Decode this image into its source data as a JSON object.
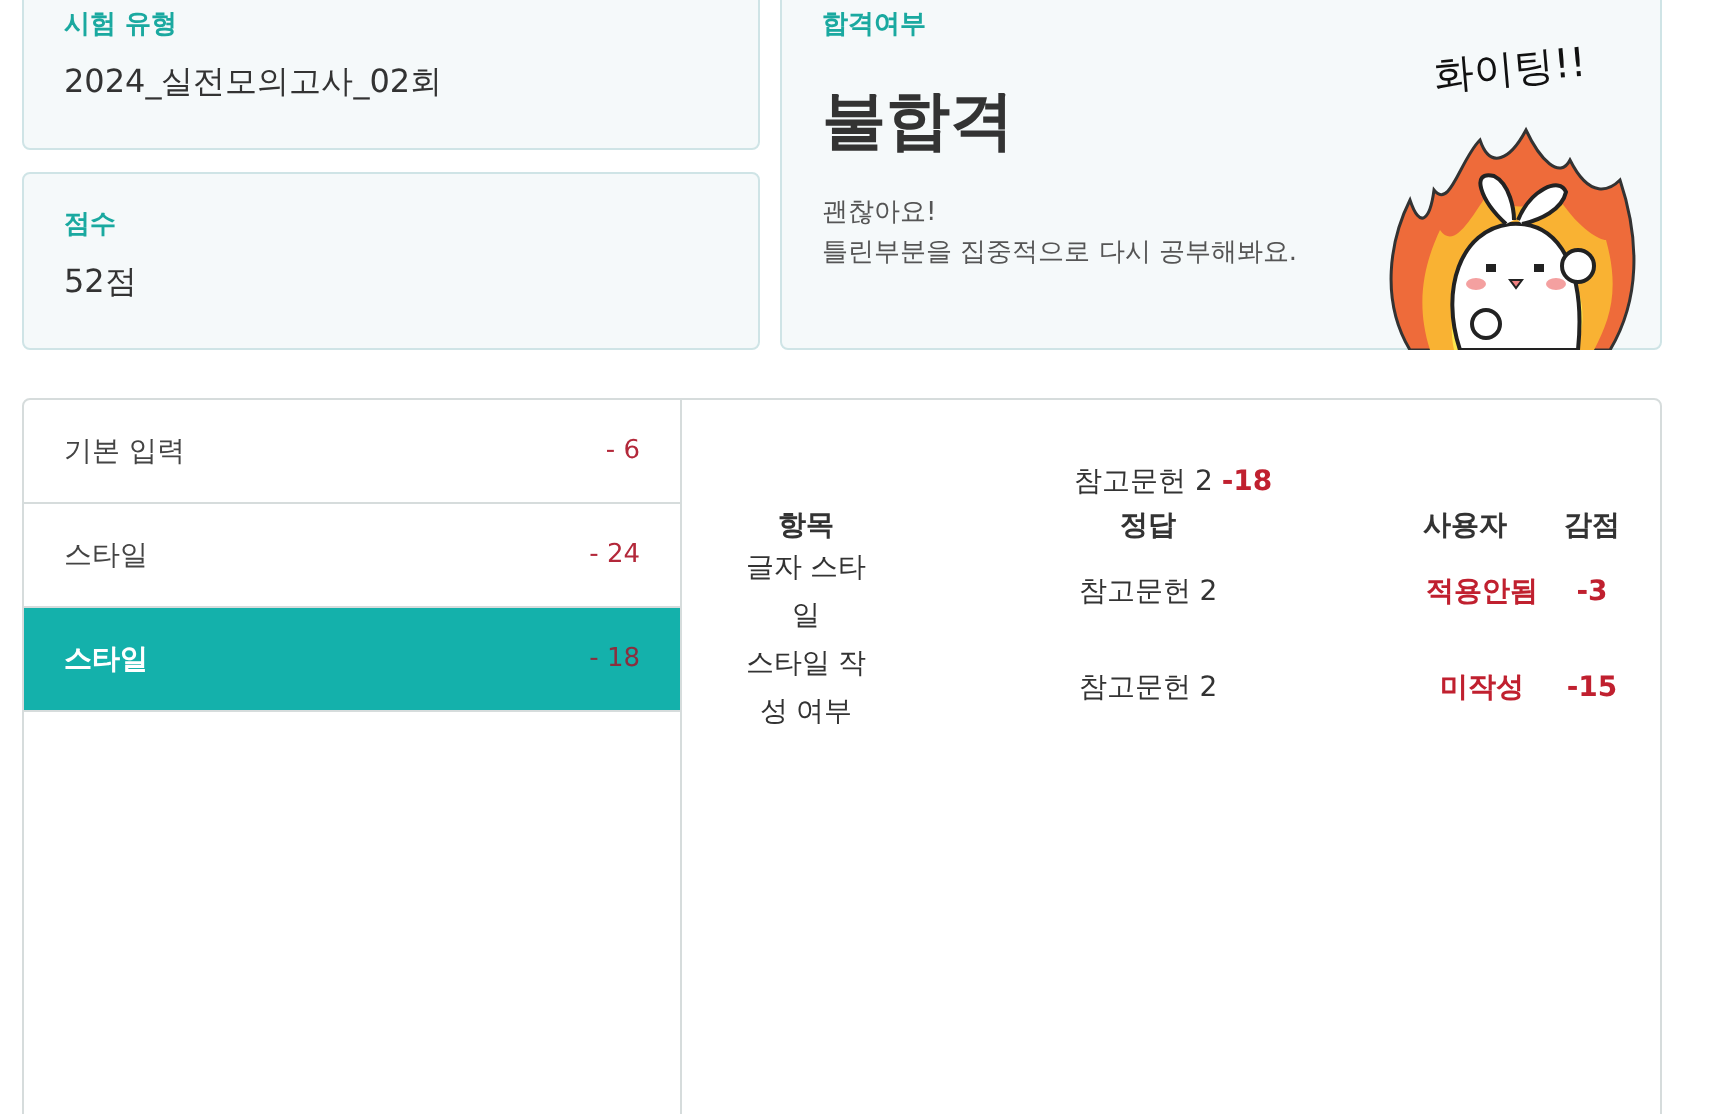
{
  "summary": {
    "exam_type": {
      "label": "시험 유형",
      "value": "2024_실전모의고사_02회"
    },
    "score": {
      "label": "점수",
      "value": "52점"
    },
    "result": {
      "label": "합격여부",
      "value": "불합격",
      "message": [
        "괜찮아요!",
        "틀린부분을 집중적으로 다시 공부해봐요."
      ],
      "sticker_text": "화이팅!!"
    }
  },
  "sidebar": {
    "items": [
      {
        "label": "기본 입력",
        "deduction": "- 6",
        "selected": false
      },
      {
        "label": "스타일",
        "deduction": "- 24",
        "selected": false
      },
      {
        "label": "스타일",
        "deduction": "- 18",
        "selected": true
      }
    ]
  },
  "detail": {
    "caption": {
      "text": "참고문헌 2",
      "deduction": "-18"
    },
    "table": {
      "columns": [
        "항목",
        "정답",
        "사용자",
        "감점"
      ],
      "rows": [
        [
          "글자 스타일",
          "참고문헌 2",
          "적용안됨",
          "-3"
        ],
        [
          "스타일 작성 여부",
          "참고문헌 2",
          "미작성",
          "-15"
        ]
      ]
    }
  }
}
